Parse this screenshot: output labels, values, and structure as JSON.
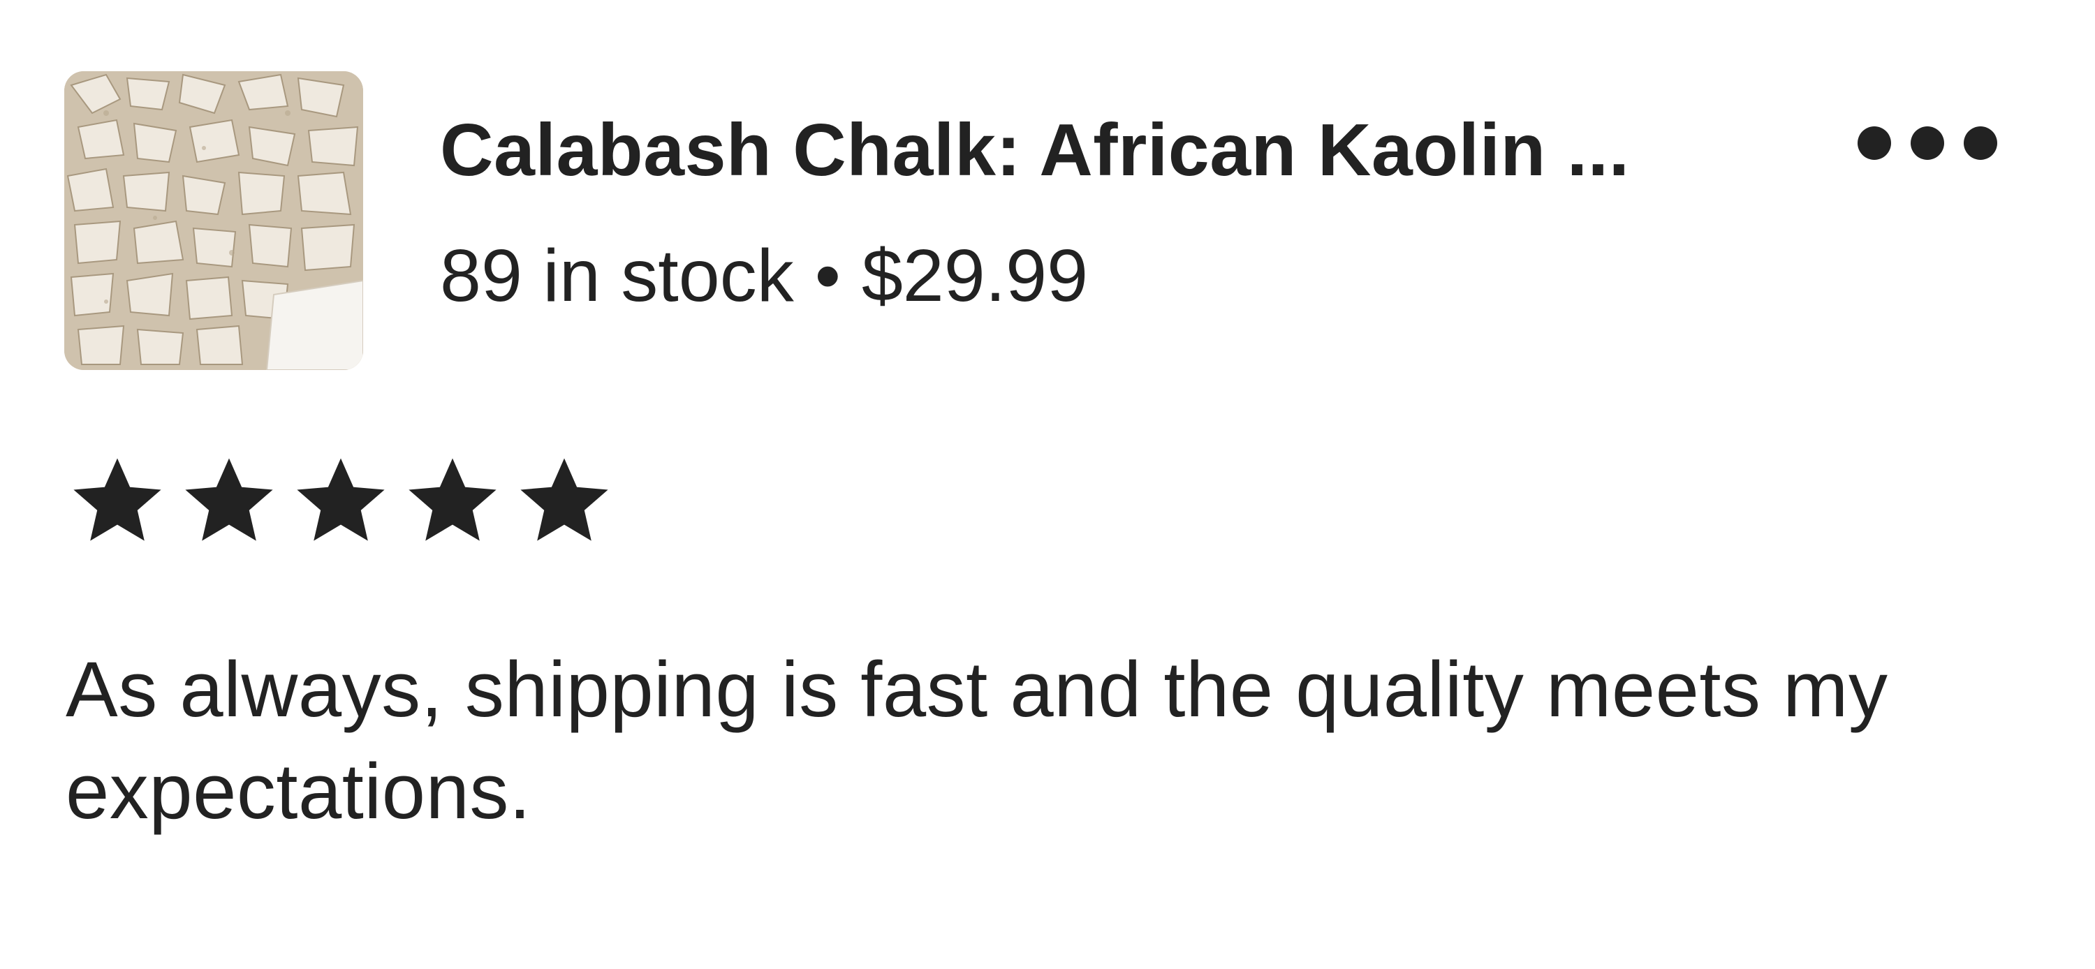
{
  "listing": {
    "title": "Calabash Chalk: African Kaolin ...",
    "stock": "89 in stock",
    "separator": "•",
    "price": "$29.99",
    "thumbnail_alt": "Calabash chalk pieces"
  },
  "review": {
    "rating": 5,
    "rating_max": 5,
    "text": "As always, shipping is fast and the quality meets my expectations."
  },
  "icons": {
    "more": "more-options-icon",
    "star": "star-icon"
  },
  "colors": {
    "text": "#222222",
    "background": "#ffffff",
    "star": "#222222"
  }
}
